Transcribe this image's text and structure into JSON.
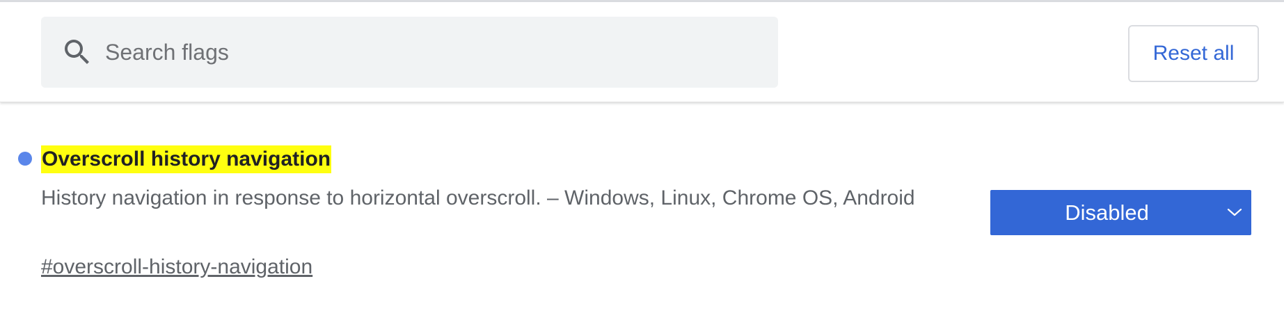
{
  "search": {
    "placeholder": "Search flags",
    "value": "",
    "icon": "search-icon"
  },
  "header": {
    "reset_label": "Reset all"
  },
  "flags": [
    {
      "title": "Overscroll history navigation",
      "description": "History navigation in response to horizontal overscroll. – Windows, Linux, Chrome OS, Android",
      "link": "#overscroll-history-navigation",
      "selected_option": "Disabled",
      "dropdown_icon": "chevron-down-icon",
      "status_dot_color": "#5a86ea",
      "highlight_color": "#ffff10"
    }
  ],
  "colors": {
    "accent": "#3367d6",
    "search_bg": "#f1f3f4",
    "text_primary": "#202124",
    "text_secondary": "#5f6368"
  }
}
